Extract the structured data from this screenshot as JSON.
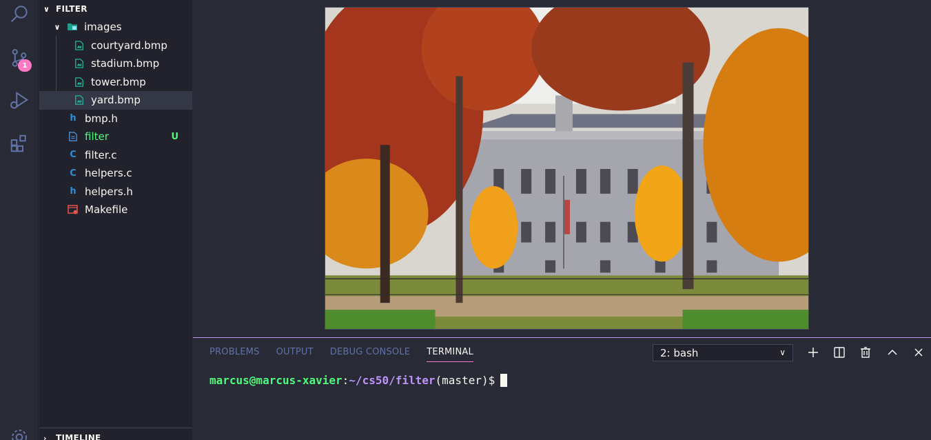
{
  "activity_bar": {
    "scm_badge": "1",
    "icons": [
      "search-icon",
      "source-control-icon",
      "run-debug-icon",
      "extensions-icon",
      "settings-gear-icon"
    ]
  },
  "explorer": {
    "section_title": "FILTER",
    "items": [
      {
        "label": "images",
        "type": "folder",
        "icon": "image-folder-icon"
      },
      {
        "label": "courtyard.bmp",
        "type": "image",
        "icon": "image-file-icon"
      },
      {
        "label": "stadium.bmp",
        "type": "image",
        "icon": "image-file-icon"
      },
      {
        "label": "tower.bmp",
        "type": "image",
        "icon": "image-file-icon"
      },
      {
        "label": "yard.bmp",
        "type": "image",
        "icon": "image-file-icon",
        "selected": true
      },
      {
        "label": "bmp.h",
        "type": "header",
        "icon": "h-file-icon",
        "glyph": "h"
      },
      {
        "label": "filter",
        "type": "file",
        "icon": "file-icon",
        "status": "U"
      },
      {
        "label": "filter.c",
        "type": "c",
        "icon": "c-file-icon",
        "glyph": "C"
      },
      {
        "label": "helpers.c",
        "type": "c",
        "icon": "c-file-icon",
        "glyph": "C"
      },
      {
        "label": "helpers.h",
        "type": "header",
        "icon": "h-file-icon",
        "glyph": "h"
      },
      {
        "label": "Makefile",
        "type": "makefile",
        "icon": "makefile-icon"
      }
    ],
    "timeline_title": "TIMELINE"
  },
  "panel": {
    "tabs": [
      "PROBLEMS",
      "OUTPUT",
      "DEBUG CONSOLE",
      "TERMINAL"
    ],
    "active_tab": "TERMINAL",
    "terminal_select": "2: bash",
    "terminal": {
      "user": "marcus@marcus-xavier",
      "colon": ":",
      "path": "~/cs50/filter",
      "branch": "(master)",
      "prompt": "$"
    }
  },
  "colors": {
    "accent": "#bd93f9",
    "pink": "#ff79c6",
    "green": "#50fa7b",
    "background": "#282a36",
    "sidebar": "#21222c"
  }
}
